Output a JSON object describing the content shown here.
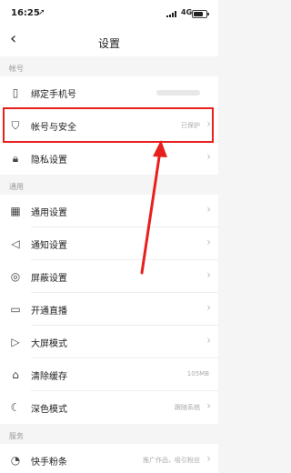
{
  "status": {
    "time": "16:25",
    "network": "4G"
  },
  "nav": {
    "title": "设置",
    "back": "‹"
  },
  "sections": {
    "account": "帐号",
    "general": "通用",
    "service": "服务"
  },
  "rows": {
    "bind_phone": {
      "label": "绑定手机号"
    },
    "security": {
      "label": "帐号与安全",
      "value": "已保护"
    },
    "privacy": {
      "label": "隐私设置"
    },
    "general": {
      "label": "通用设置"
    },
    "notify": {
      "label": "通知设置"
    },
    "block": {
      "label": "屏蔽设置"
    },
    "live": {
      "label": "开通直播"
    },
    "bigscreen": {
      "label": "大屏模式"
    },
    "cache": {
      "label": "清除缓存",
      "value": "105MB"
    },
    "dark": {
      "label": "深色模式",
      "value": "跟随系统"
    },
    "fans": {
      "label": "快手粉条",
      "value": "推广作品，吸引粉丝"
    }
  },
  "accent_color": "#e8201d"
}
